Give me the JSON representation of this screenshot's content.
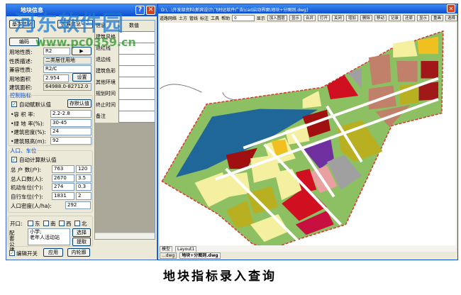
{
  "dialog": {
    "title": "地块信息",
    "help": "?",
    "close": "✕",
    "tab_basic": "基本信息",
    "tab_ext": "扩展信息<<",
    "code_label": "编码",
    "fields": [
      {
        "label": "用地性质:",
        "value": "R2"
      },
      {
        "label": "性质描述:",
        "value": "二类居住用地"
      },
      {
        "label": "兼容性质:",
        "value": "R2/C"
      },
      {
        "label": "用地面积",
        "value": "2.954"
      },
      {
        "label": "建筑面积:",
        "value": "64988.0-82712.0"
      }
    ],
    "set_btn": "设置",
    "arrow_btn": "▶",
    "control_title": "控制指标",
    "auto_default": "自动赋默认值",
    "save_default": "存默认值",
    "controls": [
      {
        "label": "•容 积 率:",
        "value": "2.2-2.8"
      },
      {
        "label": "•绿 地 率(%):",
        "value": "30-45"
      },
      {
        "label": "•建筑密度(%):",
        "value": "24"
      },
      {
        "label": "•建筑限高(m):",
        "value": "92"
      }
    ],
    "pop_title": "人口、车位",
    "auto_calc": "自动计算默认值",
    "pop": [
      {
        "label": "总 户 数(户):",
        "value": "763",
        "factor": "120"
      },
      {
        "label": "总人口数(人):",
        "value": "2670",
        "factor": "3.5"
      },
      {
        "label": "机动车位(个):",
        "value": "274",
        "factor": "0.3"
      },
      {
        "label": "自行车位(个):",
        "value": "1831",
        "factor": "2"
      }
    ],
    "density_label": "人口密度(人/ha):",
    "density_value": "292",
    "open_label": "开口:",
    "dirs": [
      "东",
      "南",
      "西",
      "北"
    ],
    "facility_label": "配套公建",
    "facilities": "小学;\n老年人活动站",
    "select_btn": "选择",
    "pick_btn": "提取",
    "edit_switch": "编辑开关",
    "apply_btn": "应用",
    "contour_btn": "内轮廓",
    "info_header": "信息",
    "value_header": "数值",
    "info_rows": [
      "建筑风格",
      "退红线",
      "退边线",
      "建筑色彩",
      "其他环境",
      "规划时间",
      "终止时间",
      "备注"
    ]
  },
  "cad": {
    "title": "D:\\...\\开发部资料\\新宾设计\\飞时达软件广告\\cad启动界面\\地块+分图则.dwg]",
    "menus": [
      "道路网络",
      "土方",
      "管线",
      "标注",
      "工具",
      "帮助"
    ],
    "layer_combo": "0",
    "show_check": "显示",
    "join_layer": "加入图层",
    "buttons": [
      "显示",
      "合并",
      "打开",
      "关闭",
      "增加",
      "删除",
      "移动",
      "记录",
      "还原",
      "显示",
      "重画",
      "选择"
    ],
    "layout_tabs": [
      "模型",
      "Layout1"
    ],
    "file_tabs": [
      "...dwg",
      "地块+分图则.dwg"
    ]
  },
  "caption": "地块指标录入查询",
  "watermark": {
    "name": "河东软件园",
    "url": "www.pc0359.cn"
  }
}
